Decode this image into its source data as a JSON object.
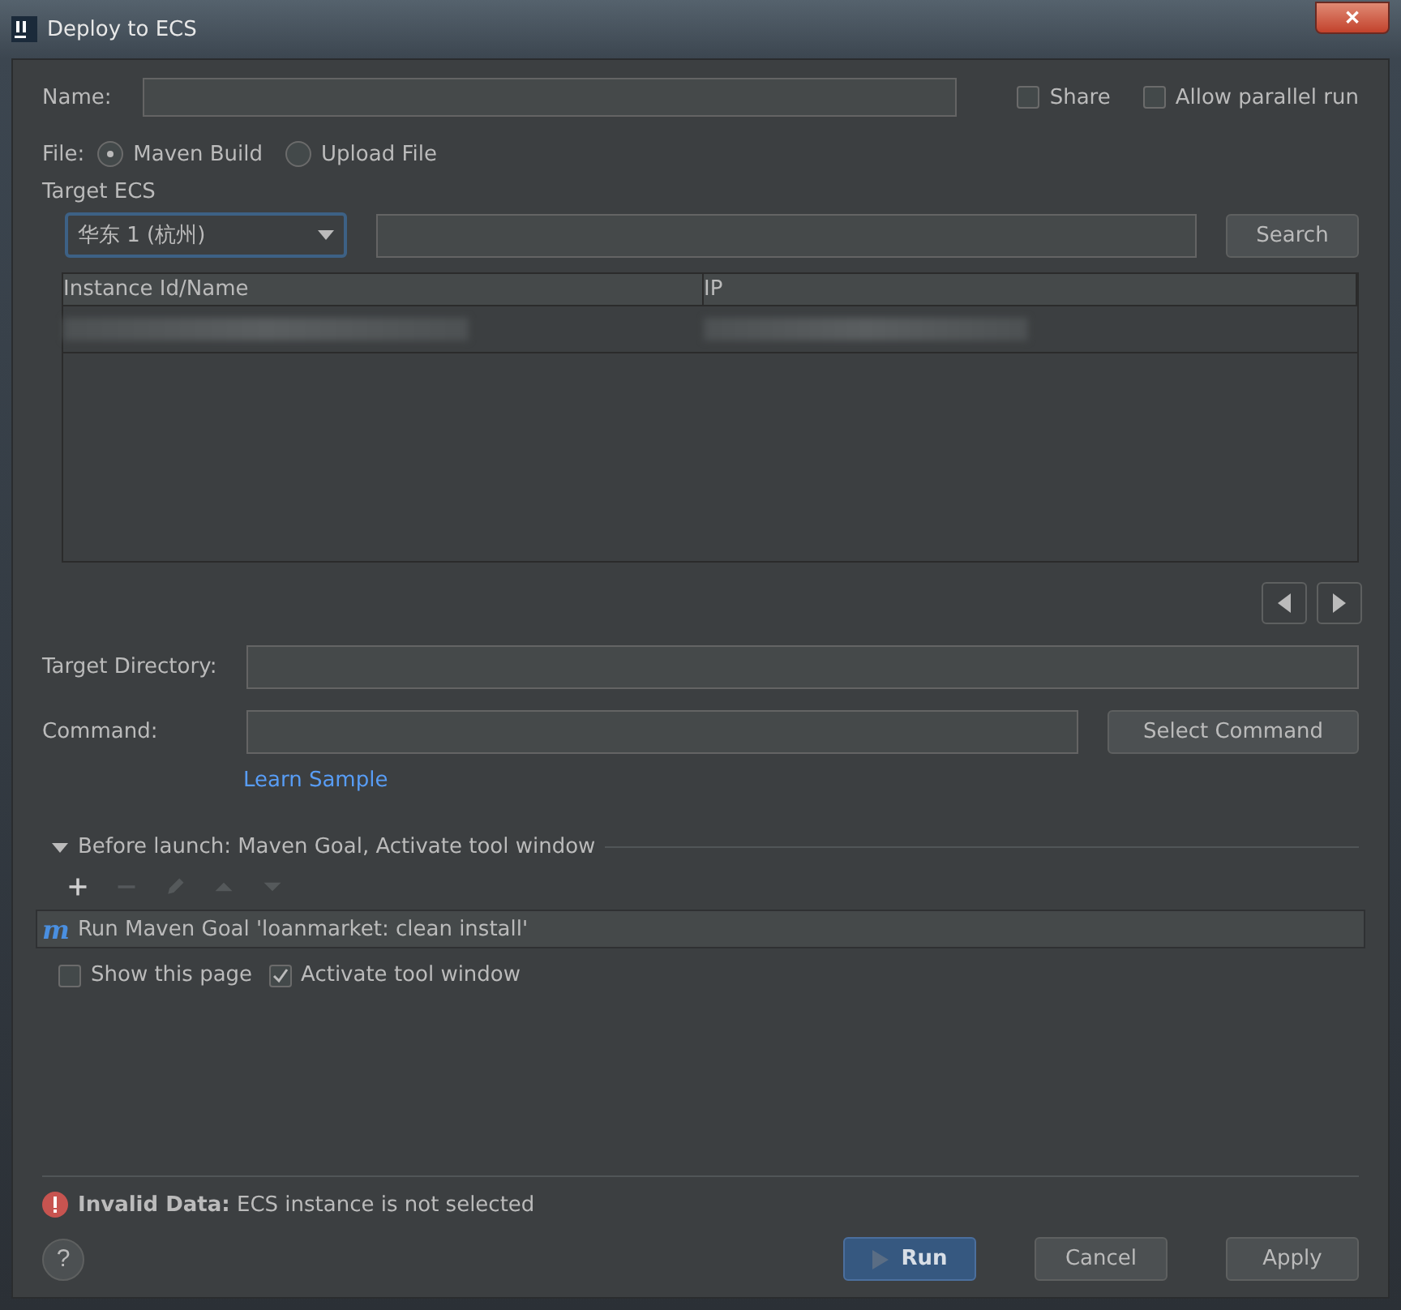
{
  "window": {
    "title": "Deploy to ECS",
    "close": "✕"
  },
  "name_field": {
    "label": "Name:"
  },
  "options": [
    {
      "label": "Share",
      "checked": false
    },
    {
      "label": "Allow parallel run",
      "checked": false
    }
  ],
  "file": {
    "label": "File:",
    "choices": [
      {
        "label": "Maven Build",
        "selected": true
      },
      {
        "label": "Upload File",
        "selected": false
      }
    ]
  },
  "target_ecs": {
    "label": "Target ECS",
    "region": "华东 1 (杭州)",
    "search_button": "Search",
    "table": {
      "columns": [
        "Instance Id/Name",
        "IP"
      ],
      "rows": [
        {
          "redacted": true
        }
      ]
    }
  },
  "target_directory": {
    "label": "Target Directory:"
  },
  "command": {
    "label": "Command:",
    "button": "Select Command",
    "link": "Learn Sample"
  },
  "before_launch": {
    "title": "Before launch: Maven Goal, Activate tool window",
    "expanded": true,
    "tools": [
      {
        "kind": "add",
        "disabled": false
      },
      {
        "kind": "remove",
        "disabled": true
      },
      {
        "kind": "edit",
        "disabled": true
      },
      {
        "kind": "up",
        "disabled": true
      },
      {
        "kind": "down",
        "disabled": true
      }
    ],
    "tasks": [
      {
        "icon": "m",
        "label": "Run Maven Goal 'loanmarket: clean install'"
      }
    ],
    "options": [
      {
        "label": "Show this page",
        "checked": false
      },
      {
        "label": "Activate tool window",
        "checked": true
      }
    ]
  },
  "validation": {
    "title": "Invalid Data:",
    "message": "ECS instance is not selected"
  },
  "help": "?",
  "buttons": [
    {
      "label": "Run",
      "primary": true
    },
    {
      "label": "Cancel",
      "primary": false
    },
    {
      "label": "Apply",
      "primary": false
    }
  ]
}
